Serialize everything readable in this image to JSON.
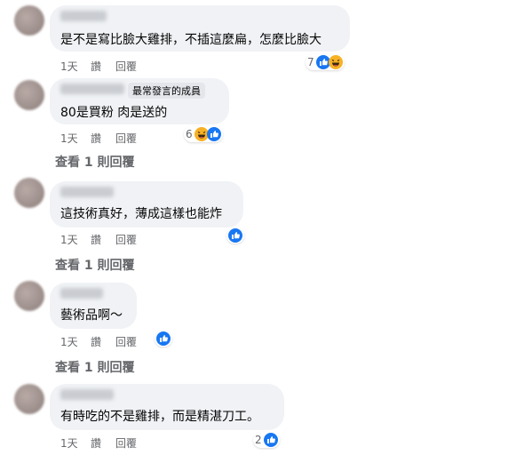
{
  "comments": [
    {
      "text": "是不是寫比臉大雞排，不插這麼扁，怎麼比臉大",
      "time": "1天",
      "like": "讚",
      "reply": "回覆",
      "reaction_count": "7",
      "reactions": [
        "like-icon",
        "haha-icon"
      ]
    },
    {
      "badge": "最常發言的成員",
      "text": "80是買粉 肉是送的",
      "time": "1天",
      "like": "讚",
      "reply": "回覆",
      "reaction_count": "6",
      "reactions": [
        "haha-icon",
        "like-icon"
      ],
      "view_replies": "查看 1 則回覆"
    },
    {
      "text": "這技術真好，薄成這樣也能炸",
      "time": "1天",
      "like": "讚",
      "reply": "回覆",
      "reaction_count": "",
      "reactions": [
        "like-icon"
      ],
      "view_replies": "查看 1 則回覆"
    },
    {
      "text": "藝術品啊～",
      "time": "1天",
      "like": "讚",
      "reply": "回覆",
      "reaction_count": "",
      "reactions": [
        "like-icon"
      ],
      "view_replies": "查看 1 則回覆"
    },
    {
      "text": "有時吃的不是雞排，而是精湛刀工。",
      "time": "1天",
      "like": "讚",
      "reply": "回覆",
      "reaction_count": "2",
      "reactions": [
        "like-icon"
      ]
    }
  ],
  "colors": {
    "bubble": "#f0f2f5",
    "like": "#1877f2",
    "haha": "#f7b125",
    "meta": "#65676b"
  }
}
